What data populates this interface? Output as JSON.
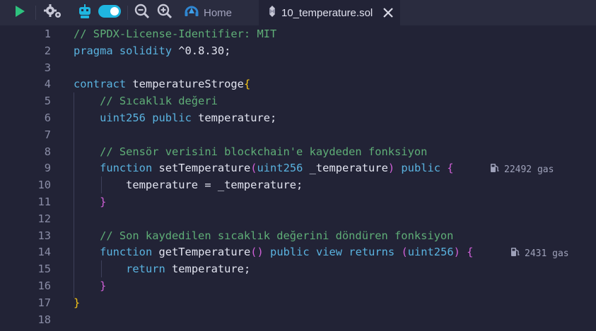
{
  "toolbar": {
    "run_icon": "play-icon",
    "settings_icon": "gears-icon",
    "ai_icon": "robot-icon",
    "toggle_state": "on",
    "zoom_out_icon": "zoom-out-icon",
    "zoom_in_icon": "zoom-in-icon"
  },
  "tabs": [
    {
      "label": "Home",
      "icon": "remix-logo-icon"
    },
    {
      "label": "10_temperature.sol",
      "icon": "solidity-icon",
      "active": true,
      "close_icon": "close-icon"
    }
  ],
  "code_lines": [
    {
      "n": "1",
      "tokens": [
        {
          "t": "// SPDX-License-Identifier: MIT",
          "c": "com"
        }
      ]
    },
    {
      "n": "2",
      "tokens": [
        {
          "t": "pragma solidity",
          "c": "kw"
        },
        {
          "t": " ^0.8.30;",
          "c": "txt"
        }
      ]
    },
    {
      "n": "3",
      "tokens": []
    },
    {
      "n": "4",
      "tokens": [
        {
          "t": "contract",
          "c": "kw"
        },
        {
          "t": " temperatureStroge",
          "c": "txt"
        },
        {
          "t": "{",
          "c": "br1"
        }
      ]
    },
    {
      "n": "5",
      "tokens": [
        {
          "t": "    // Sıcaklık değeri",
          "c": "com"
        }
      ]
    },
    {
      "n": "6",
      "tokens": [
        {
          "t": "    ",
          "c": "txt"
        },
        {
          "t": "uint256",
          "c": "ty"
        },
        {
          "t": " ",
          "c": "txt"
        },
        {
          "t": "public",
          "c": "kw"
        },
        {
          "t": " temperature;",
          "c": "txt"
        }
      ]
    },
    {
      "n": "7",
      "tokens": []
    },
    {
      "n": "8",
      "tokens": [
        {
          "t": "    // Sensör verisini blockchain'e kaydeden fonksiyon",
          "c": "com"
        }
      ]
    },
    {
      "n": "9",
      "tokens": [
        {
          "t": "    ",
          "c": "txt"
        },
        {
          "t": "function",
          "c": "kw"
        },
        {
          "t": " setTemperature",
          "c": "txt"
        },
        {
          "t": "(",
          "c": "br2"
        },
        {
          "t": "uint256",
          "c": "ty"
        },
        {
          "t": " _temperature",
          "c": "txt"
        },
        {
          "t": ")",
          "c": "br2"
        },
        {
          "t": " ",
          "c": "txt"
        },
        {
          "t": "public",
          "c": "kw"
        },
        {
          "t": " ",
          "c": "txt"
        },
        {
          "t": "{",
          "c": "br2"
        }
      ]
    },
    {
      "n": "10",
      "tokens": [
        {
          "t": "        temperature = _temperature;",
          "c": "txt"
        }
      ]
    },
    {
      "n": "11",
      "tokens": [
        {
          "t": "    ",
          "c": "txt"
        },
        {
          "t": "}",
          "c": "br2"
        }
      ]
    },
    {
      "n": "12",
      "tokens": []
    },
    {
      "n": "13",
      "tokens": [
        {
          "t": "    // Son kaydedilen sıcaklık değerini döndüren fonksiyon",
          "c": "com"
        }
      ]
    },
    {
      "n": "14",
      "tokens": [
        {
          "t": "    ",
          "c": "txt"
        },
        {
          "t": "function",
          "c": "kw"
        },
        {
          "t": " getTemperature",
          "c": "txt"
        },
        {
          "t": "()",
          "c": "br2"
        },
        {
          "t": " ",
          "c": "txt"
        },
        {
          "t": "public",
          "c": "kw"
        },
        {
          "t": " ",
          "c": "txt"
        },
        {
          "t": "view",
          "c": "kw"
        },
        {
          "t": " ",
          "c": "txt"
        },
        {
          "t": "returns",
          "c": "kw"
        },
        {
          "t": " ",
          "c": "txt"
        },
        {
          "t": "(",
          "c": "br2"
        },
        {
          "t": "uint256",
          "c": "ty"
        },
        {
          "t": ")",
          "c": "br2"
        },
        {
          "t": " ",
          "c": "txt"
        },
        {
          "t": "{",
          "c": "br2"
        }
      ]
    },
    {
      "n": "15",
      "tokens": [
        {
          "t": "        ",
          "c": "txt"
        },
        {
          "t": "return",
          "c": "kw"
        },
        {
          "t": " temperature;",
          "c": "txt"
        }
      ]
    },
    {
      "n": "16",
      "tokens": [
        {
          "t": "    ",
          "c": "txt"
        },
        {
          "t": "}",
          "c": "br2"
        }
      ]
    },
    {
      "n": "17",
      "tokens": [
        {
          "t": "}",
          "c": "br1"
        }
      ]
    },
    {
      "n": "18",
      "tokens": []
    }
  ],
  "gas_hints": [
    {
      "line": "9",
      "text": "22492 gas",
      "icon": "fuel-pump-icon"
    },
    {
      "line": "14",
      "text": "2431 gas",
      "icon": "fuel-pump-icon"
    }
  ],
  "colors": {
    "background": "#222336",
    "toolbar": "#2a2c3f",
    "keyword": "#5ab3e0",
    "comment": "#5fae77",
    "text": "#e2e4f0",
    "bracket_outer": "#f5c518",
    "bracket_inner": "#d060d8",
    "accent_green": "#2ec27e",
    "accent_cyan": "#1fb6e0"
  }
}
